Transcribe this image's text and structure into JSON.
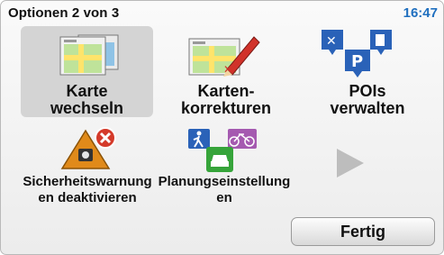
{
  "header": {
    "title": "Optionen 2 von 3",
    "time": "16:47"
  },
  "tiles": [
    {
      "line1": "Karte",
      "line2": "wechseln",
      "icon": "map-switch-icon"
    },
    {
      "line1": "Karten-",
      "line2": "korrekturen",
      "icon": "map-correction-icon"
    },
    {
      "line1": "POIs",
      "line2": "verwalten",
      "icon": "poi-icon"
    },
    {
      "line1": "Sicherheitswarnung",
      "line2": "en deaktivieren",
      "icon": "speed-camera-warning-icon"
    },
    {
      "line1": "Planungseinstellung",
      "line2": "en",
      "icon": "route-planning-icon"
    }
  ],
  "next_icon": "next-arrow-icon",
  "footer": {
    "done_label": "Fertig"
  },
  "colors": {
    "time": "#1f6fbf",
    "poi_blue": "#2a62b8",
    "warning_orange": "#e08a1a",
    "close_red": "#d43a2a",
    "route_green": "#36a43a"
  }
}
